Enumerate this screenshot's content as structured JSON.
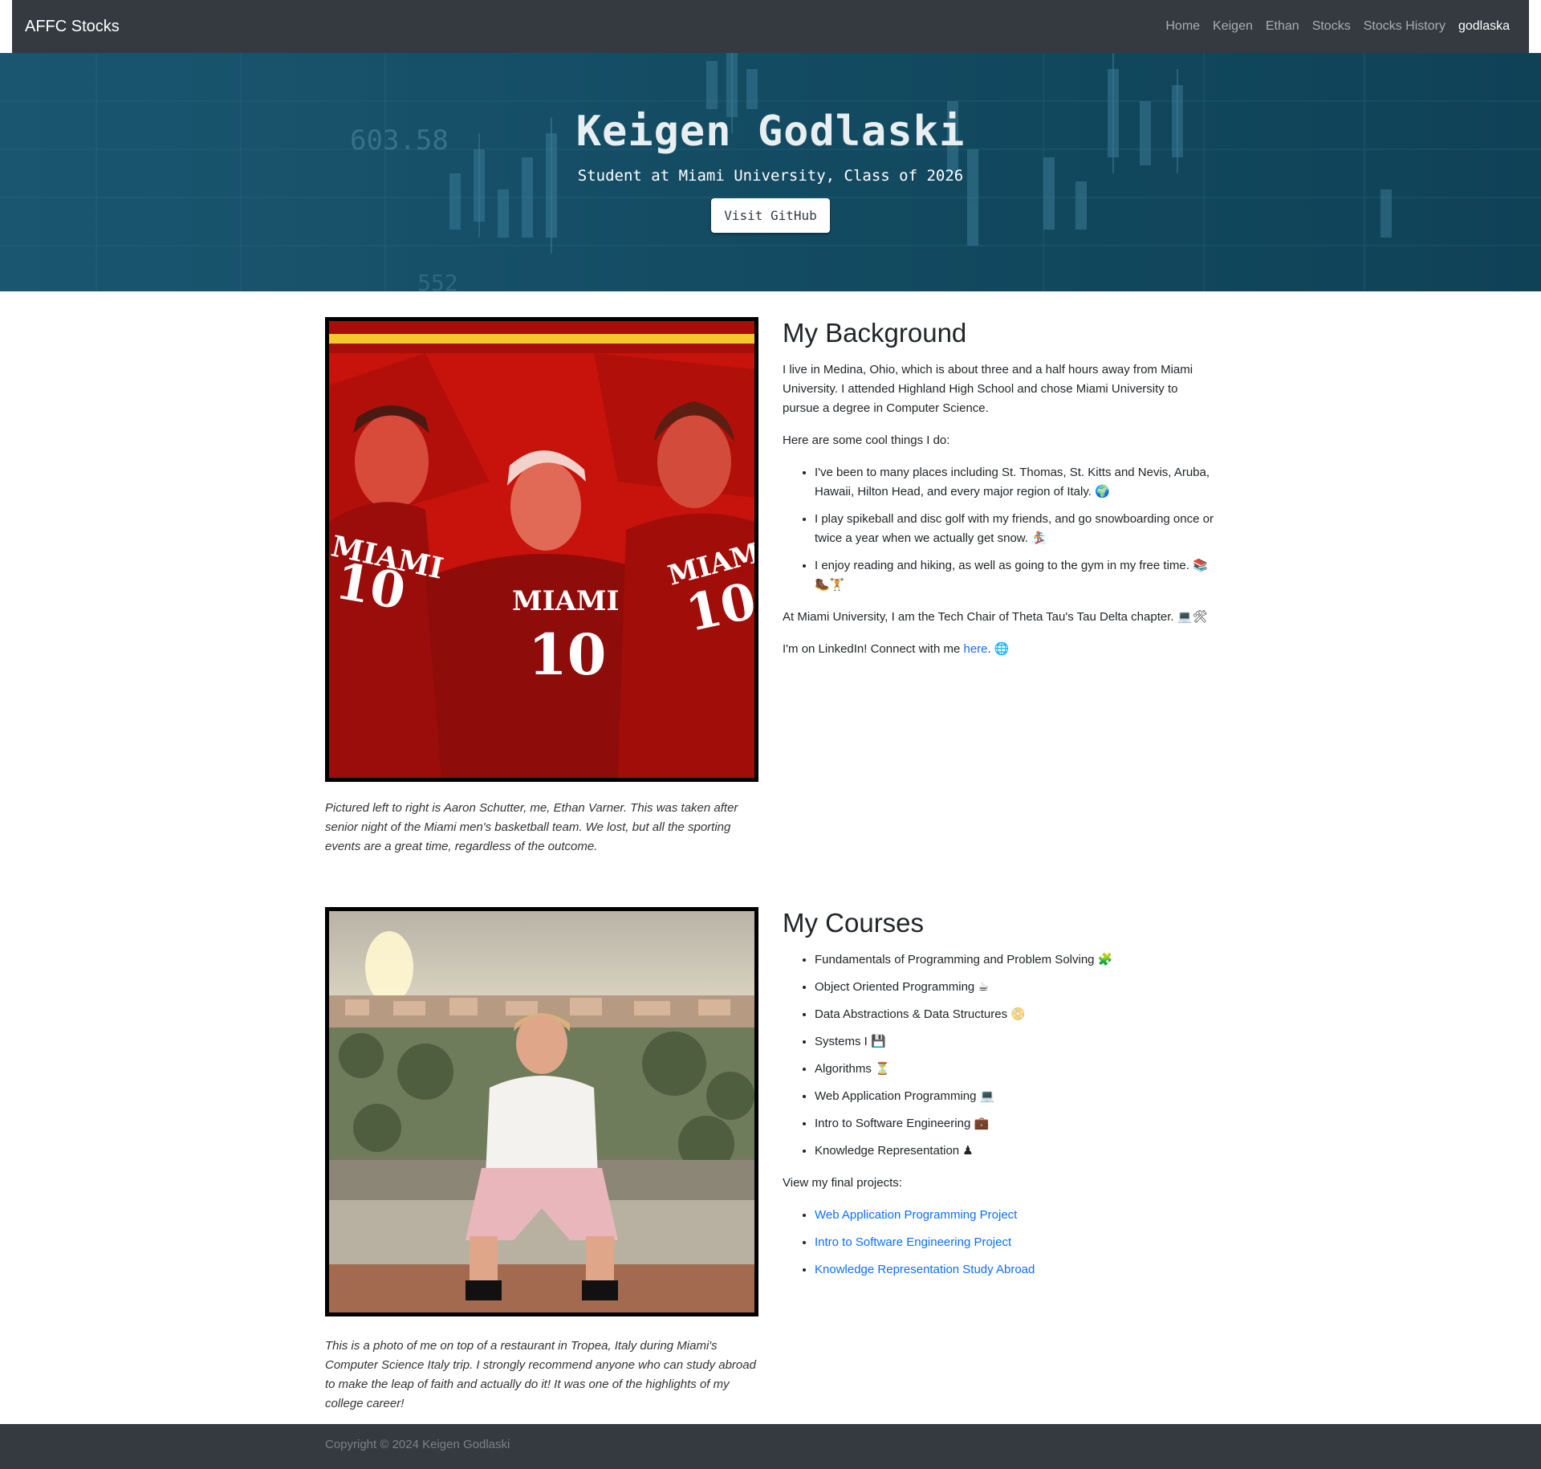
{
  "navbar": {
    "brand": "AFFC Stocks",
    "links": [
      "Home",
      "Keigen",
      "Ethan",
      "Stocks",
      "Stocks History",
      "godlaska"
    ]
  },
  "hero": {
    "title": "Keigen Godlaski",
    "subtitle": "Student at Miami University, Class of 2026",
    "button_label": "Visit GitHub",
    "bg_numbers": [
      "603.58",
      "552"
    ]
  },
  "background_section": {
    "heading": "My Background",
    "intro": "I live in Medina, Ohio, which is about three and a half hours away from Miami University. I attended Highland High School and chose Miami University to pursue a degree in Computer Science.",
    "cool_things_intro": "Here are some cool things I do:",
    "items": [
      "I've been to many places including St. Thomas, St. Kitts and Nevis, Aruba, Hawaii, Hilton Head, and every major region of Italy. 🌍",
      "I play spikeball and disc golf with my friends, and go snowboarding once or twice a year when we actually get snow. 🏂",
      "I enjoy reading and hiking, as well as going to the gym in my free time. 📚🥾🏋"
    ],
    "tech_chair": "At Miami University, I am the Tech Chair of Theta Tau's Tau Delta chapter. 💻🛠",
    "linkedin_prefix": "I'm on LinkedIn! Connect with me ",
    "linkedin_link": "here",
    "linkedin_suffix": ". 🌐",
    "photo_jersey_text": [
      "MIAMI",
      "10"
    ],
    "caption": "Pictured left to right is Aaron Schutter, me, Ethan Varner. This was taken after senior night of the Miami men's basketball team. We lost, but all the sporting events are a great time, regardless of the outcome."
  },
  "courses_section": {
    "heading": "My Courses",
    "courses": [
      "Fundamentals of Programming and Problem Solving 🧩",
      "Object Oriented Programming ☕",
      "Data Abstractions & Data Structures 📀",
      "Systems I 💾",
      "Algorithms ⏳",
      "Web Application Programming 💻",
      "Intro to Software Engineering 💼",
      "Knowledge Representation ♟"
    ],
    "projects_intro": "View my final projects:",
    "projects": [
      "Web Application Programming Project",
      "Intro to Software Engineering Project",
      "Knowledge Representation Study Abroad"
    ],
    "caption": "This is a photo of me on top of a restaurant in Tropea, Italy during Miami's Computer Science Italy trip. I strongly recommend anyone who can study abroad to make the leap of faith and actually do it! It was one of the highlights of my college career!"
  },
  "footer": {
    "copyright": "Copyright © 2024 Keigen Godlaski"
  },
  "colors": {
    "navbar_bg": "#343a40",
    "hero_bg": "#124a60",
    "link": "#0d6efd",
    "footer_bg": "#343a40"
  }
}
